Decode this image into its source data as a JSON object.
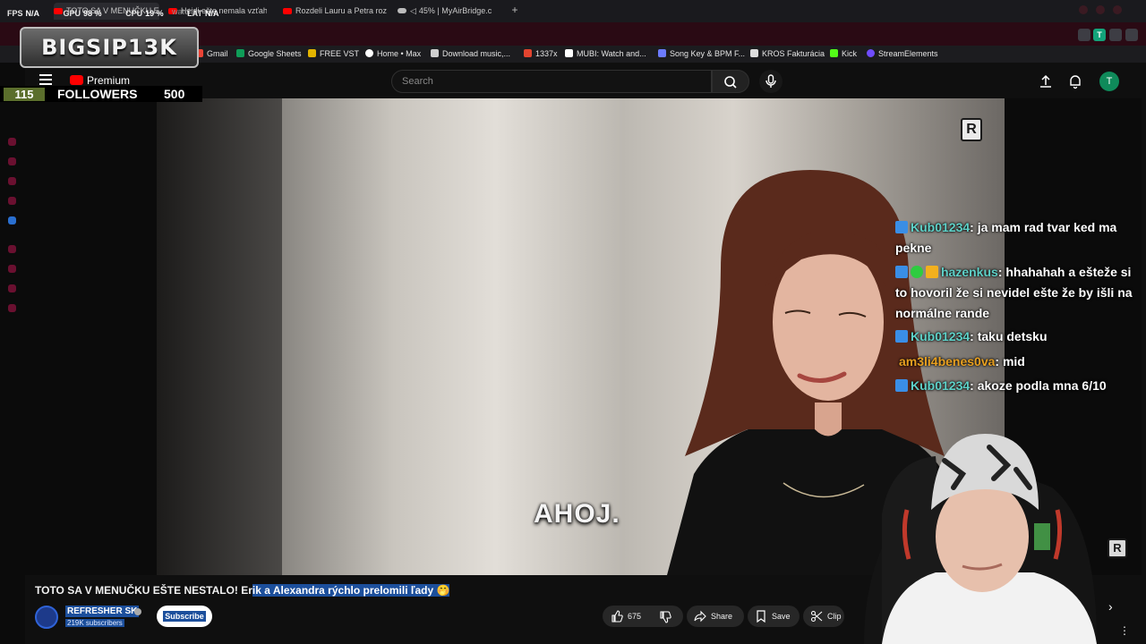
{
  "browser": {
    "tabs": [
      {
        "label": "TOTO SA V MENUČKU EŠ",
        "active": true,
        "kind": "youtube"
      },
      {
        "label": "Heidi ešte nemala vzťah.",
        "active": false,
        "kind": "youtube"
      },
      {
        "label": "Rozdeli Lauru a Petra rozd",
        "active": false,
        "kind": "youtube"
      },
      {
        "label": "45% | MyAirBridge.c",
        "active": false,
        "kind": "cloud"
      }
    ],
    "new_tab": "+",
    "url_fragment": "watch",
    "bookmarks": [
      {
        "label": "Gmail",
        "color": "#ea4335"
      },
      {
        "label": "Google Sheets",
        "color": "#0f9d58"
      },
      {
        "label": "FREE VST",
        "color": "#e3b400"
      },
      {
        "label": "Home • Max",
        "color": "#ffffff"
      },
      {
        "label": "Download music,...",
        "color": "#cfcfcf"
      },
      {
        "label": "1337x",
        "color": "#e2442f"
      },
      {
        "label": "MUBI: Watch and...",
        "color": "#ffffff"
      },
      {
        "label": "Song Key & BPM F...",
        "color": "#6c7bff"
      },
      {
        "label": "KROS Fakturácia",
        "color": "#dddddd"
      },
      {
        "label": "Kick",
        "color": "#53fc18"
      },
      {
        "label": "StreamElements",
        "color": "#6f4cff"
      }
    ],
    "extension_avatar": "T"
  },
  "overlay": {
    "stats": [
      {
        "label": "FPS",
        "value": "N/A"
      },
      {
        "label": "GPU",
        "value": "98 %"
      },
      {
        "label": "CPU",
        "value": "19 %"
      },
      {
        "label": "LAT",
        "value": "N/A"
      }
    ],
    "logo_text": "BIGSIP13K",
    "followers_current": "115",
    "followers_label": "FOLLOWERS",
    "followers_goal": "500"
  },
  "youtube": {
    "premium_label": "Premium",
    "search_placeholder": "Search",
    "avatar_letter": "T",
    "subtitle": "AHOJ.",
    "watermark": "R",
    "video_title_plain": "TOTO SA V MENUČKU EŠTE NESTALO! Er",
    "video_title_selected": "ik a Alexandra rýchlo prelomili ľady 🤭",
    "channel_name": "REFRESHER SK",
    "channel_subs": "219K subscribers",
    "subscribe_label": "Subscribe",
    "likes": "675",
    "share_label": "Share",
    "save_label": "Save",
    "clip_label": "Clip"
  },
  "chat": [
    {
      "user": "Kub01234",
      "user_color": "#5ed1c8",
      "text": ": ja mam rad tvar ked ma pekne",
      "badges": 1
    },
    {
      "user": "hazenkus",
      "user_color": "#5ed1c8",
      "text": ": hhahahah a ešteže si to hovoril že si nevidel ešte že by išli na normálne rande",
      "badges": 3
    },
    {
      "user": "Kub01234",
      "user_color": "#5ed1c8",
      "text": ": taku detsku",
      "badges": 1
    },
    {
      "user": "am3li4benes0va",
      "user_color": "#e8a020",
      "text": ": mid",
      "badges": 0
    },
    {
      "user": "Kub01234",
      "user_color": "#5ed1c8",
      "text": ": akoze podla mna 6/10",
      "badges": 1
    }
  ],
  "colors": {
    "accent_blue": "#1c4f9c",
    "youtube_red": "#ff0000",
    "address_bar": "#2a0a14"
  }
}
